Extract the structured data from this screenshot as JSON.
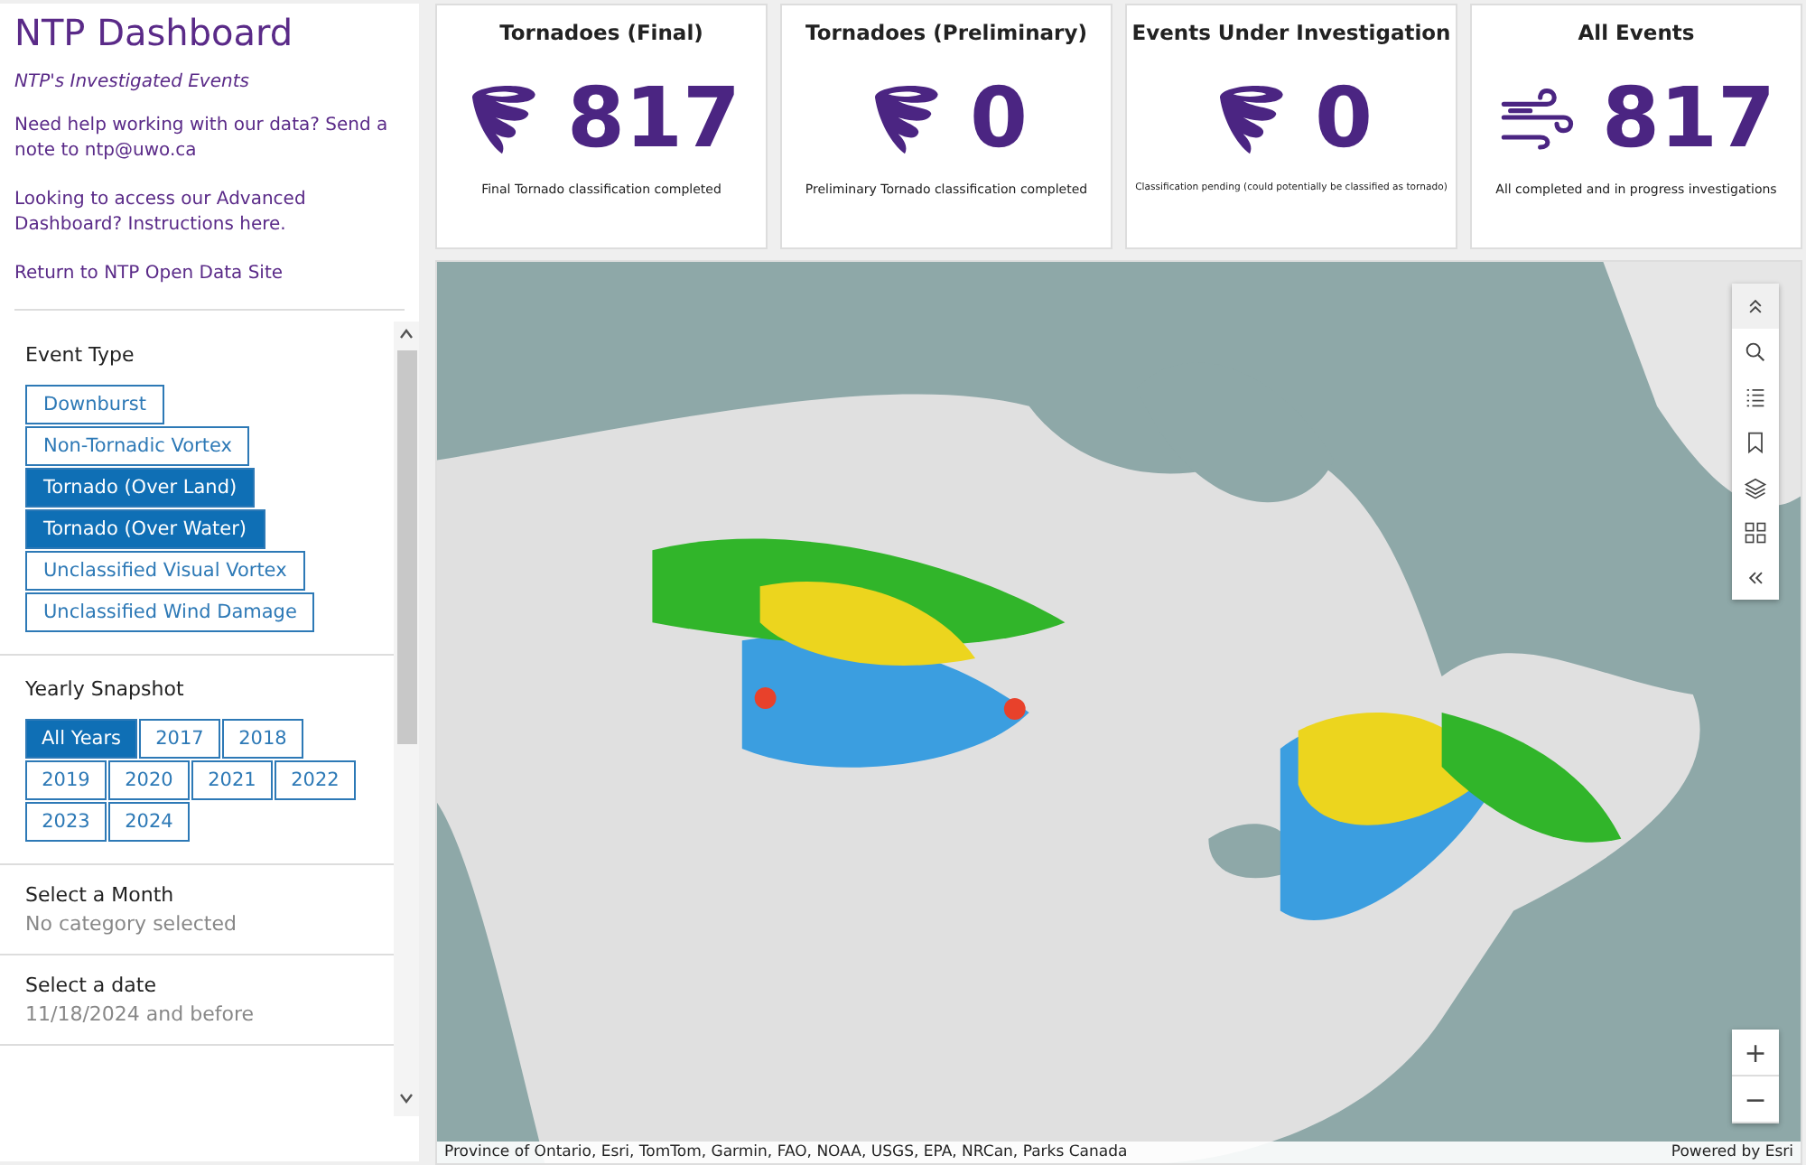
{
  "sidebar": {
    "title": "NTP Dashboard",
    "subtitle": "NTP's Investigated Events",
    "paragraphs": [
      "Need help working with our data? Send a note to ntp@uwo.ca",
      "Looking to access our Advanced Dashboard? Instructions here.",
      "Return to NTP Open Data Site"
    ]
  },
  "filters": {
    "event_type": {
      "title": "Event Type",
      "options": [
        {
          "label": "Downburst",
          "selected": false
        },
        {
          "label": "Non-Tornadic Vortex",
          "selected": false
        },
        {
          "label": "Tornado (Over Land)",
          "selected": true
        },
        {
          "label": "Tornado (Over Water)",
          "selected": true
        },
        {
          "label": "Unclassified Visual Vortex",
          "selected": false
        },
        {
          "label": "Unclassified Wind Damage",
          "selected": false
        }
      ]
    },
    "yearly_snapshot": {
      "title": "Yearly Snapshot",
      "options": [
        {
          "label": "All Years",
          "selected": true
        },
        {
          "label": "2017",
          "selected": false
        },
        {
          "label": "2018",
          "selected": false
        },
        {
          "label": "2019",
          "selected": false
        },
        {
          "label": "2020",
          "selected": false
        },
        {
          "label": "2021",
          "selected": false
        },
        {
          "label": "2022",
          "selected": false
        },
        {
          "label": "2023",
          "selected": false
        },
        {
          "label": "2024",
          "selected": false
        }
      ]
    },
    "month": {
      "title": "Select a Month",
      "value": "No category selected"
    },
    "date": {
      "title": "Select a date",
      "value": "11/18/2024 and before"
    }
  },
  "cards": [
    {
      "title": "Tornadoes (Final)",
      "value": "817",
      "caption": "Final Tornado classification completed",
      "kind": "tornado"
    },
    {
      "title": "Tornadoes (Preliminary)",
      "value": "0",
      "caption": "Preliminary Tornado classification completed",
      "kind": "tornado"
    },
    {
      "title": "Events Under Investigation",
      "value": "0",
      "caption": "Classification pending (could potentially be classified as tornado)",
      "kind": "tornado"
    },
    {
      "title": "All Events",
      "value": "817",
      "caption": "All completed and in progress investigations",
      "kind": "wind"
    }
  ],
  "map": {
    "kind": "picture",
    "zoom_in": "+",
    "zoom_out": "−",
    "attribution": "Province of Ontario, Esri, TomTom, Garmin, FAO, NOAA, USGS, EPA, NRCan, Parks Canada",
    "powered_by": "Powered by Esri"
  }
}
